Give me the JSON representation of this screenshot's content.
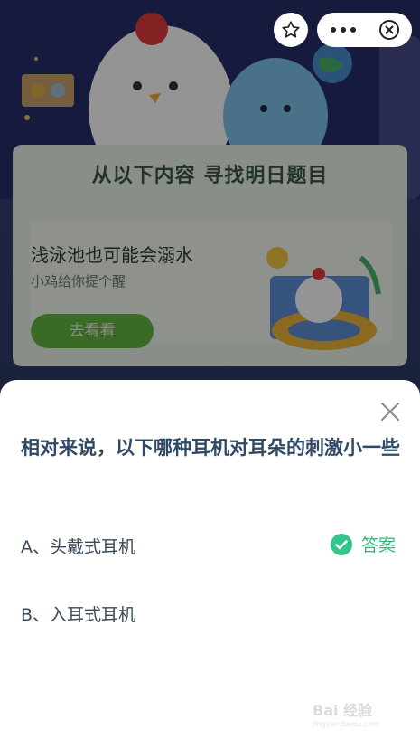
{
  "banner": {
    "card_title": "从以下内容 寻找明日题目",
    "tip_title": "浅泳池也可能会溺水",
    "tip_subtitle": "小鸡给你提个醒",
    "tip_button": "去看看"
  },
  "mini_program_bar": {
    "favorite_icon": "star-outline-icon",
    "more_icon": "more-dots-icon",
    "close_icon": "circle-close-icon"
  },
  "quiz": {
    "question": "相对来说，以下哪种耳机对耳朵的刺激小一些",
    "options": [
      {
        "label": "A、头戴式耳机",
        "is_answer": true
      },
      {
        "label": "B、入耳式耳机",
        "is_answer": false
      }
    ],
    "answer_label": "答案",
    "answer_color": "#34c58a"
  },
  "watermark": {
    "text": "Bai 经验",
    "sub": "jingyan.baidu.com"
  }
}
